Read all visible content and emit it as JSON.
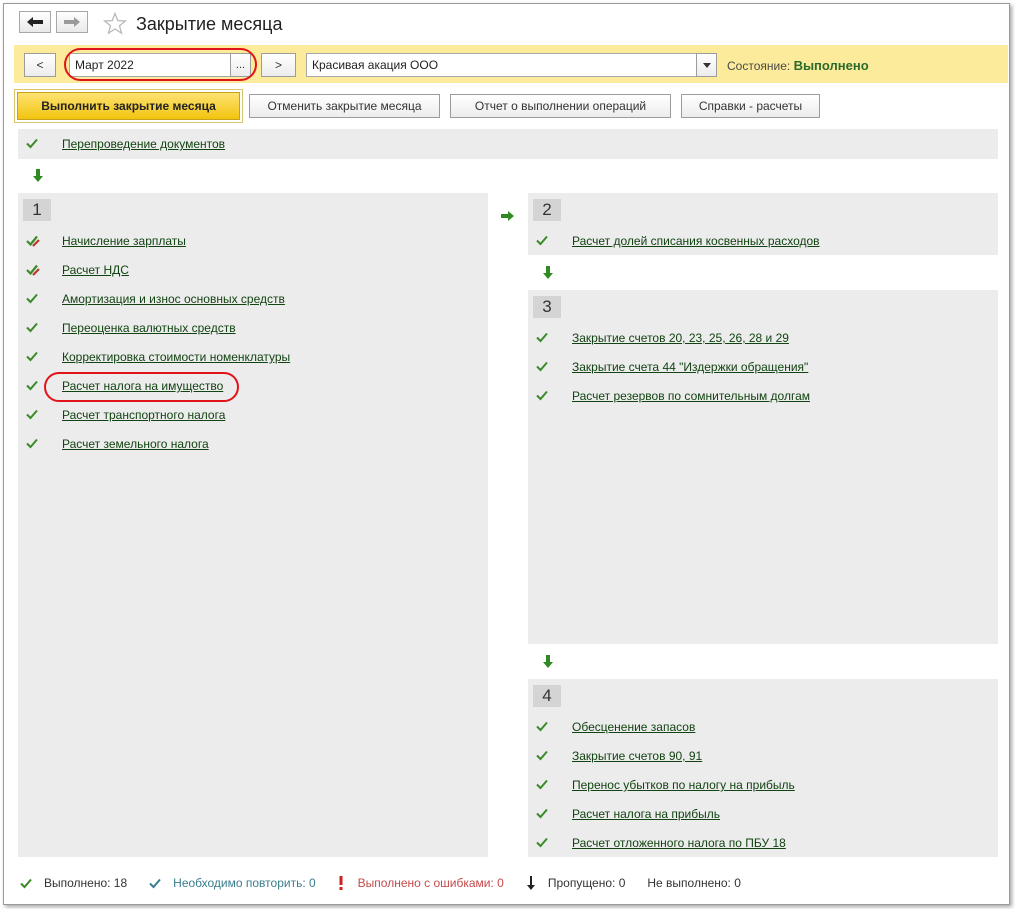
{
  "window": {
    "title": "Закрытие месяца"
  },
  "toolbar": {
    "period": "Март 2022",
    "period_select": "...",
    "prev": "<",
    "next": ">",
    "organization": "Красивая акация ООО",
    "status_label": "Состояние:",
    "status_value": "Выполнено"
  },
  "actions": {
    "execute": "Выполнить закрытие месяца",
    "cancel": "Отменить закрытие месяца",
    "report": "Отчет о выполнении операций",
    "references": "Справки - расчеты"
  },
  "top_item": "Перепроведение документов",
  "groups": {
    "g1": {
      "number": "1",
      "items": [
        "Начисление зарплаты",
        "Расчет НДС",
        "Амортизация и износ основных средств",
        "Переоценка валютных средств",
        "Корректировка стоимости номенклатуры",
        "Расчет налога на имущество",
        "Расчет транспортного налога",
        "Расчет земельного налога"
      ]
    },
    "g2": {
      "number": "2",
      "items": [
        "Расчет долей списания косвенных расходов"
      ]
    },
    "g3": {
      "number": "3",
      "items": [
        "Закрытие счетов 20, 23, 25, 26, 28 и 29",
        "Закрытие счета 44 \"Издержки обращения\"",
        "Расчет резервов по сомнительным долгам"
      ]
    },
    "g4": {
      "number": "4",
      "items": [
        "Обесценение запасов",
        "Закрытие счетов 90, 91",
        "Перенос убытков по налогу на прибыль",
        "Расчет налога на прибыль",
        "Расчет отложенного налога по ПБУ 18"
      ]
    }
  },
  "footer": {
    "done": "Выполнено: 18",
    "repeat": "Необходимо повторить: 0",
    "errors": "Выполнено с ошибками: 0",
    "skipped": "Пропущено: 0",
    "not_done": "Не выполнено: 0"
  },
  "colors": {
    "check_green": "#3a8a2a",
    "link_green": "#124312",
    "highlight_red": "#e0141a",
    "status_bar": "#fbeb9a",
    "execute_button": "#f5cf1b",
    "repeat_teal": "#3a7d8c",
    "error_red": "#c44a4a"
  }
}
